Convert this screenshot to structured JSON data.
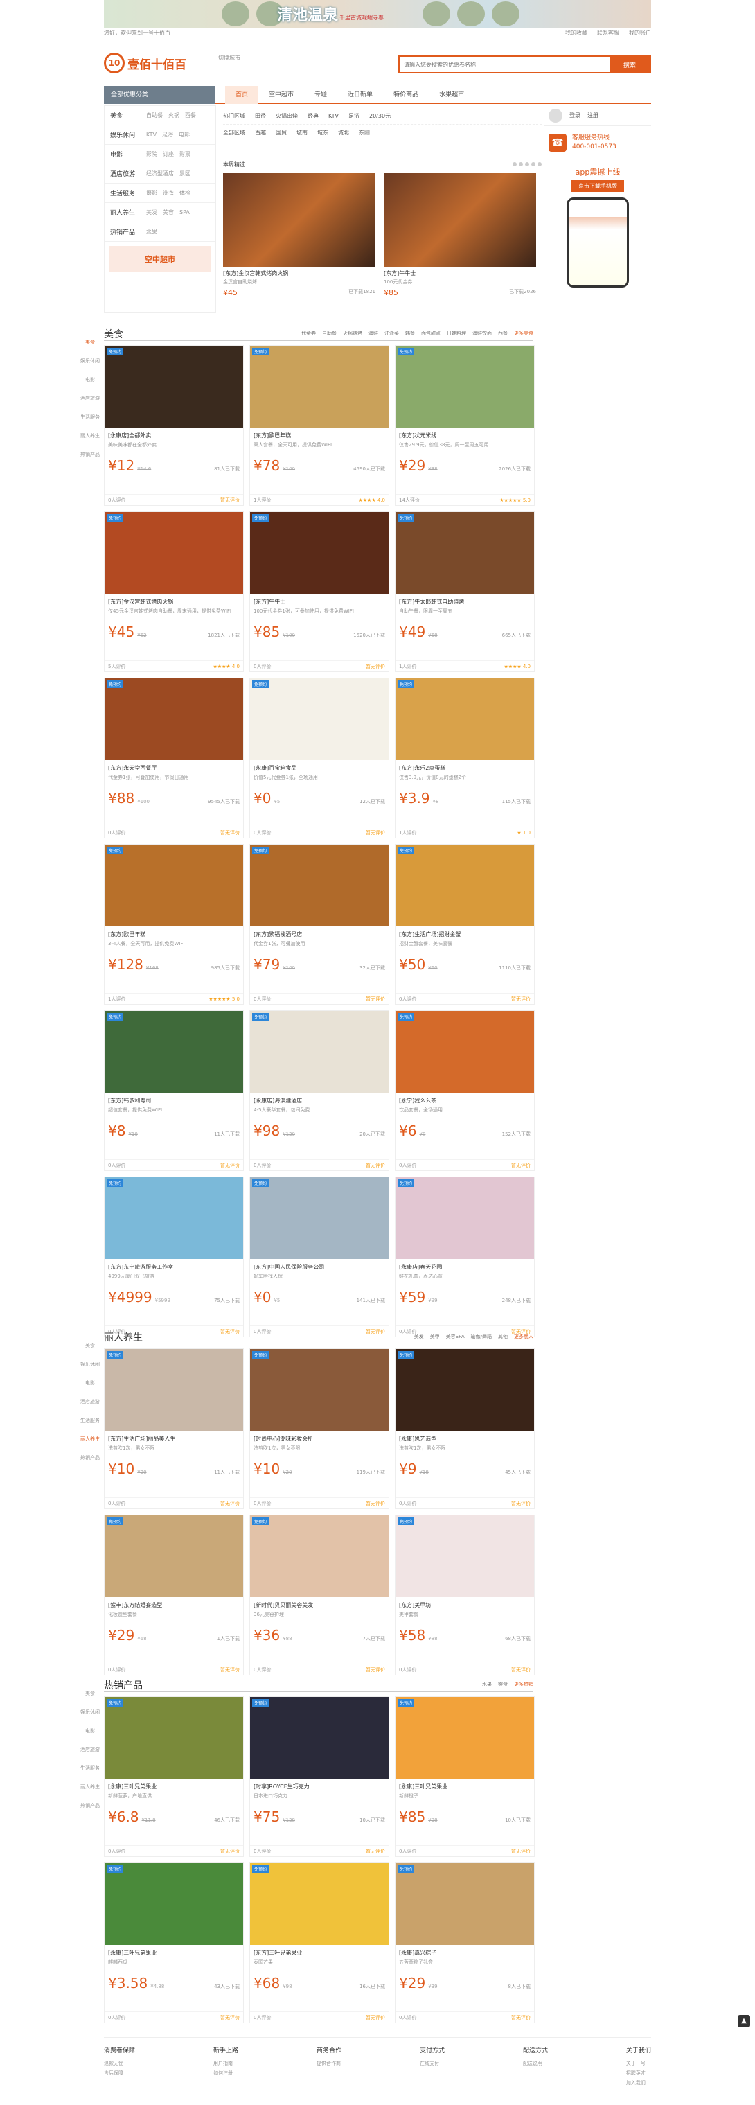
{
  "banner": {
    "text": "清池温泉",
    "sub": "千里古城观鲤寻春"
  },
  "topbar": {
    "left": "您好，欢迎来到一号十佰百",
    "links": [
      "我的收藏",
      "联系客服",
      "我的账户"
    ]
  },
  "header": {
    "logo": "壹佰十佰百",
    "city": "切换城市",
    "search_placeholder": "请输入您要搜索的优惠卷名称",
    "search_btn": "搜索"
  },
  "nav": {
    "cat": "全部优惠分类",
    "items": [
      "首页",
      "空中超市",
      "专题",
      "近日新单",
      "特价商品",
      "水果超市"
    ]
  },
  "side": [
    {
      "n": "美食",
      "s": [
        "自助餐",
        "火锅",
        "西餐"
      ]
    },
    {
      "n": "娱乐休闲",
      "s": [
        "KTV",
        "足浴",
        "电影"
      ]
    },
    {
      "n": "电影",
      "s": [
        "影院",
        "订座",
        "影票"
      ]
    },
    {
      "n": "酒店旅游",
      "s": [
        "经济型酒店",
        "景区"
      ]
    },
    {
      "n": "生活服务",
      "s": [
        "摄影",
        "洗衣",
        "体检"
      ]
    },
    {
      "n": "丽人养生",
      "s": [
        "美发",
        "美容",
        "SPA"
      ]
    },
    {
      "n": "热销产品",
      "s": [
        "水果"
      ]
    }
  ],
  "side_ad": "空中超市",
  "filters": [
    [
      "热门区域",
      "田径",
      "火锅串烧",
      "经典",
      "KTV",
      "足浴",
      "20/30元"
    ],
    [
      "全部区域",
      "百越",
      "国贸",
      "城南",
      "城东",
      "城北",
      "东阳"
    ]
  ],
  "featured": {
    "title": "本周精选",
    "items": [
      {
        "t": "[东方]金汉宫韩式烤肉火锅",
        "d": "金汉宫自助烧烤",
        "p": "¥45",
        "s": "已下载1821"
      },
      {
        "t": "[东方]牛牛士",
        "d": "100元代金券",
        "p": "¥85",
        "s": "已下载2026"
      }
    ]
  },
  "right": {
    "login": "登录",
    "reg": "注册",
    "hot_title": "客服服务热线",
    "hot_phone": "400-001-0573",
    "app": "app震撼上线",
    "app_btn": "点击下载手机版"
  },
  "sections": [
    {
      "name": "美食",
      "tags": [
        "代金券",
        "自助餐",
        "火锅烧烤",
        "海鲜",
        "江浙菜",
        "韩餐",
        "面包甜点",
        "日韩料理",
        "海鲜饺面",
        "西餐"
      ],
      "more": "更多美食",
      "cards": [
        {
          "t": "[永康店]全都外卖",
          "d": "美味美味都在全都外卖",
          "p": "¥12",
          "o": "¥14.6",
          "s": "81人已下载",
          "f": "0人评价",
          "r": "暂无评价",
          "c": "#3a2a1e"
        },
        {
          "t": "[东方]欧巴年糕",
          "d": "双人套餐，全天可用，提供免费WIFI",
          "p": "¥78",
          "o": "¥100",
          "s": "4590人已下载",
          "f": "1人评价",
          "r": "★★★★ 4.0",
          "c": "#c9a15a"
        },
        {
          "t": "[东方]状元米线",
          "d": "仅售29.9元，价值38元，周一至周五可用",
          "p": "¥29",
          "o": "¥38",
          "s": "2026人已下载",
          "f": "14人评价",
          "r": "★★★★★ 5.0",
          "c": "#8aaa6a"
        },
        {
          "t": "[东方]金汉宫韩式烤肉火锅",
          "d": "仅45元金汉宫韩式烤肉自助餐，周末通用，提供免费WIFI",
          "p": "¥45",
          "o": "¥52",
          "s": "1821人已下载",
          "f": "5人评价",
          "r": "★★★★ 4.0",
          "c": "#b34a22"
        },
        {
          "t": "[东方]牛牛士",
          "d": "100元代金券1张，可叠加使用，提供免费WIFI",
          "p": "¥85",
          "o": "¥100",
          "s": "1520人已下载",
          "f": "0人评价",
          "r": "暂无评价",
          "c": "#5a2a18"
        },
        {
          "t": "[东方]牛太郎韩式自助烧烤",
          "d": "自助午餐，限周一至周五",
          "p": "¥49",
          "o": "¥58",
          "s": "665人已下载",
          "f": "1人评价",
          "r": "★★★★ 4.0",
          "c": "#7a4a2a"
        },
        {
          "t": "[东方]永天堂西餐厅",
          "d": "代金券1张，可叠加使用，节假日通用",
          "p": "¥88",
          "o": "¥100",
          "s": "9545人已下载",
          "f": "0人评价",
          "r": "暂无评价",
          "c": "#9c4a22"
        },
        {
          "t": "[永康]百宝箱食品",
          "d": "价值5元代金券1张，全场通用",
          "p": "¥0",
          "o": "¥5",
          "s": "12人已下载",
          "f": "0人评价",
          "r": "暂无评价",
          "c": "#f4f1e8"
        },
        {
          "t": "[东方]永乐2点蛋糕",
          "d": "仅售3.9元，价值8元的蛋糕2个",
          "p": "¥3.9",
          "o": "¥8",
          "s": "115人已下载",
          "f": "1人评价",
          "r": "★ 1.0",
          "c": "#d9a24a"
        },
        {
          "t": "[东方]欧巴年糕",
          "d": "3-4人餐，全天可用，提供免费WIFI",
          "p": "¥128",
          "o": "¥168",
          "s": "985人已下载",
          "f": "1人评价",
          "r": "★★★★★ 5.0",
          "c": "#b8702a"
        },
        {
          "t": "[东方]繁福楼酒号店",
          "d": "代金券1张，可叠加使用",
          "p": "¥79",
          "o": "¥100",
          "s": "32人已下载",
          "f": "0人评价",
          "r": "暂无评价",
          "c": "#b06a2a"
        },
        {
          "t": "[东方]生活广场]招财金蟹",
          "d": "招财金蟹套餐，美味饕餮",
          "p": "¥50",
          "o": "¥60",
          "s": "1110人已下载",
          "f": "0人评价",
          "r": "暂无评价",
          "c": "#d89a3a"
        },
        {
          "t": "[东方]韩多利寿司",
          "d": "超值套餐，提供免费WIFI",
          "p": "¥8",
          "o": "¥10",
          "s": "11人已下载",
          "f": "0人评价",
          "r": "暂无评价",
          "c": "#3f6a3a"
        },
        {
          "t": "[永康店]海滨建酒店",
          "d": "4-5人豪华套餐，包间免费",
          "p": "¥98",
          "o": "¥120",
          "s": "20人已下载",
          "f": "0人评价",
          "r": "暂无评价",
          "c": "#e8e2d6"
        },
        {
          "t": "[永宁]我么么茶",
          "d": "饮品套餐，全场通用",
          "p": "¥6",
          "o": "¥8",
          "s": "152人已下载",
          "f": "0人评价",
          "r": "暂无评价",
          "c": "#d46a2a"
        },
        {
          "t": "[东方]东宁旅游服务工作室",
          "d": "4999元厦门双飞旅游",
          "p": "¥4999",
          "o": "¥5999",
          "s": "75人已下载",
          "f": "0人评价",
          "r": "暂无评价",
          "c": "#7bb9d9"
        },
        {
          "t": "[东方]中国人民保险服务公司",
          "d": "好车险找人保",
          "p": "¥0",
          "o": "¥5",
          "s": "141人已下载",
          "f": "0人评价",
          "r": "暂无评价",
          "c": "#a4b6c4"
        },
        {
          "t": "[永康店]春天花园",
          "d": "鲜花礼盒，表达心意",
          "p": "¥59",
          "o": "¥99",
          "s": "248人已下载",
          "f": "0人评价",
          "r": "暂无评价",
          "c": "#e2c6d2"
        }
      ]
    },
    {
      "name": "丽人养生",
      "tags": [
        "美发",
        "美甲",
        "美容SPA",
        "瑜伽/舞蹈",
        "其他"
      ],
      "more": "更多丽人",
      "cards": [
        {
          "t": "[东方]生活广场]丽品美人生",
          "d": "洗剪吹1次，男女不限",
          "p": "¥10",
          "o": "¥20",
          "s": "11人已下载",
          "f": "0人评价",
          "r": "暂无评价",
          "c": "#c9b8a8"
        },
        {
          "t": "[时尚中心]潮味彩妆会所",
          "d": "洗剪吹1次，男女不限",
          "p": "¥10",
          "o": "¥20",
          "s": "119人已下载",
          "f": "0人评价",
          "r": "暂无评价",
          "c": "#8a5a3a"
        },
        {
          "t": "[永康]思艺造型",
          "d": "洗剪吹1次，男女不限",
          "p": "¥9",
          "o": "¥18",
          "s": "45人已下载",
          "f": "0人评价",
          "r": "暂无评价",
          "c": "#3a2418"
        },
        {
          "t": "[紫丰]东方结婚宴造型",
          "d": "化妆造型套餐",
          "p": "¥29",
          "o": "¥68",
          "s": "1人已下载",
          "f": "0人评价",
          "r": "暂无评价",
          "c": "#c9a878"
        },
        {
          "t": "[新时代]贝贝丽美容美发",
          "d": "36元美容护理",
          "p": "¥36",
          "o": "¥88",
          "s": "7人已下载",
          "f": "0人评价",
          "r": "暂无评价",
          "c": "#e2c2a8"
        },
        {
          "t": "[东方]美甲坊",
          "d": "美甲套餐",
          "p": "¥58",
          "o": "¥88",
          "s": "68人已下载",
          "f": "0人评价",
          "r": "暂无评价",
          "c": "#f1e4e4"
        }
      ]
    },
    {
      "name": "热销产品",
      "tags": [
        "水果",
        "零食"
      ],
      "more": "更多热销",
      "cards": [
        {
          "t": "[永康]三叶兄弟果业",
          "d": "新鲜菠萝，产地直供",
          "p": "¥6.8",
          "o": "¥11.8",
          "s": "46人已下载",
          "f": "0人评价",
          "r": "暂无评价",
          "c": "#7a8a3a"
        },
        {
          "t": "[时享]ROYCE生巧克力",
          "d": "日本进口巧克力",
          "p": "¥75",
          "o": "¥128",
          "s": "10人已下载",
          "f": "0人评价",
          "r": "暂无评价",
          "c": "#2a2a3a"
        },
        {
          "t": "[永康]三叶兄弟果业",
          "d": "新鲜橙子",
          "p": "¥85",
          "o": "¥98",
          "s": "10人已下载",
          "f": "0人评价",
          "r": "暂无评价",
          "c": "#f2a23a"
        },
        {
          "t": "[永康]三叶兄弟果业",
          "d": "麒麟西瓜",
          "p": "¥3.58",
          "o": "¥4.88",
          "s": "43人已下载",
          "f": "0人评价",
          "r": "暂无评价",
          "c": "#4a8a3a"
        },
        {
          "t": "[东方]三叶兄弟果业",
          "d": "泰国芒果",
          "p": "¥68",
          "o": "¥98",
          "s": "16人已下载",
          "f": "0人评价",
          "r": "暂无评价",
          "c": "#f0c23a"
        },
        {
          "t": "[永康]嘉兴粽子",
          "d": "五芳斋粽子礼盒",
          "p": "¥29",
          "o": "¥39",
          "s": "8人已下载",
          "f": "0人评价",
          "r": "暂无评价",
          "c": "#c9a26a"
        }
      ]
    }
  ],
  "footer": [
    {
      "h": "消费者保障",
      "l": [
        "退款无忧",
        "售后保障"
      ]
    },
    {
      "h": "新手上路",
      "l": [
        "用户指南",
        "如何注册"
      ]
    },
    {
      "h": "商务合作",
      "l": [
        "提供合作商"
      ]
    },
    {
      "h": "支付方式",
      "l": [
        "在线支付"
      ]
    },
    {
      "h": "配送方式",
      "l": [
        "配送说明"
      ]
    },
    {
      "h": "关于我们",
      "l": [
        "关于一号十",
        "招聘英才",
        "加入我们"
      ]
    }
  ]
}
